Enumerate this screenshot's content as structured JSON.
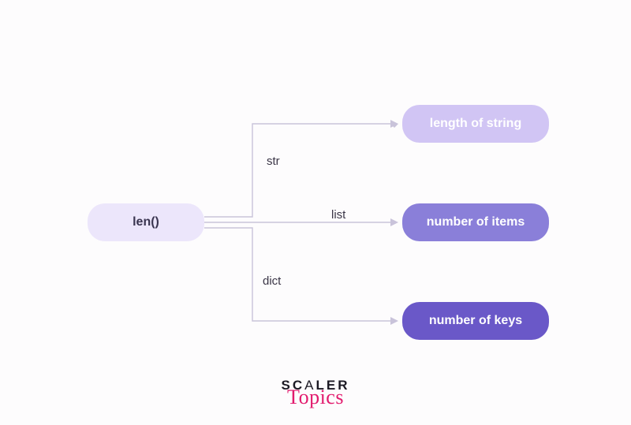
{
  "source": {
    "label": "len()"
  },
  "branches": [
    {
      "edge_label": "str",
      "result": "length of string"
    },
    {
      "edge_label": "list",
      "result": "number of items"
    },
    {
      "edge_label": "dict",
      "result": "number of keys"
    }
  ],
  "logo": {
    "line1_a": "SC",
    "line1_b": "A",
    "line1_c": "LER",
    "line2": "Topics"
  }
}
